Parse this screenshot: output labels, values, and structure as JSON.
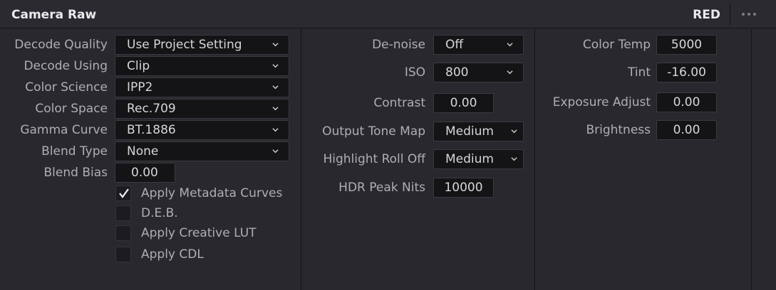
{
  "header": {
    "title": "Camera Raw",
    "badge": "RED"
  },
  "col1": {
    "decode_quality": {
      "label": "Decode Quality",
      "value": "Use Project Setting"
    },
    "decode_using": {
      "label": "Decode Using",
      "value": "Clip"
    },
    "color_science": {
      "label": "Color Science",
      "value": "IPP2"
    },
    "color_space": {
      "label": "Color Space",
      "value": "Rec.709"
    },
    "gamma_curve": {
      "label": "Gamma Curve",
      "value": "BT.1886"
    },
    "blend_type": {
      "label": "Blend Type",
      "value": "None"
    },
    "blend_bias": {
      "label": "Blend Bias",
      "value": "0.00"
    },
    "checkboxes": [
      {
        "label": "Apply Metadata Curves",
        "checked": true
      },
      {
        "label": "D.E.B.",
        "checked": false
      },
      {
        "label": "Apply Creative LUT",
        "checked": false
      },
      {
        "label": "Apply CDL",
        "checked": false
      }
    ]
  },
  "col2": {
    "denoise": {
      "label": "De-noise",
      "value": "Off"
    },
    "iso": {
      "label": "ISO",
      "value": "800"
    },
    "contrast": {
      "label": "Contrast",
      "value": "0.00"
    },
    "output_tone_map": {
      "label": "Output Tone Map",
      "value": "Medium"
    },
    "highlight_roll_off": {
      "label": "Highlight Roll Off",
      "value": "Medium"
    },
    "hdr_peak_nits": {
      "label": "HDR Peak Nits",
      "value": "10000"
    }
  },
  "col3": {
    "color_temp": {
      "label": "Color Temp",
      "value": "5000"
    },
    "tint": {
      "label": "Tint",
      "value": "-16.00"
    },
    "exposure_adjust": {
      "label": "Exposure Adjust",
      "value": "0.00"
    },
    "brightness": {
      "label": "Brightness",
      "value": "0.00"
    }
  }
}
